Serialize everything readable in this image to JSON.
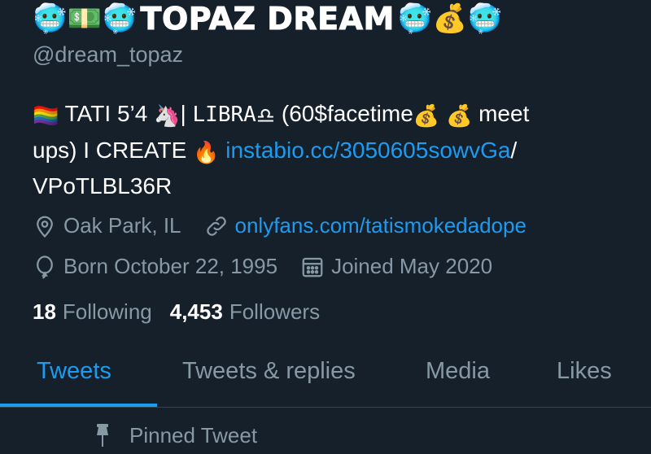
{
  "profile": {
    "display_name": "TOPAZ DREAM",
    "name_emojis_left": [
      "🥶",
      "💵",
      "🥶"
    ],
    "name_emojis_right": [
      "🥶",
      "💰",
      "🥶"
    ],
    "handle": "@dream_topaz"
  },
  "bio": {
    "line1_flag": "🏳️‍🌈",
    "line1_text_a": "TATI 5’4",
    "line1_emoji_unicorn": "🦄",
    "line1_sep": "|",
    "line1_libra_word": "LIBRA",
    "line1_libra_sign": "♎",
    "line1_text_b": "(60$facetime",
    "line1_money1": "💰",
    "line1_money2": "💰",
    "line1_text_c": "meet",
    "line2_text_a": "ups) I CREATE",
    "line2_fire": "🔥",
    "line2_link": "instabio.cc/3050605sowvGa",
    "line2_slash": "/",
    "line3_text": "VPoTLBL36R"
  },
  "meta": {
    "location": "Oak Park, IL",
    "website": "onlyfans.com/tatismokedadope",
    "birthday": "Born October 22, 1995",
    "joined": "Joined May 2020"
  },
  "stats": {
    "following_count": "18",
    "following_label": "Following",
    "followers_count": "4,453",
    "followers_label": "Followers"
  },
  "tabs": {
    "tweets": "Tweets",
    "replies": "Tweets & replies",
    "media": "Media",
    "likes": "Likes",
    "active": "tweets"
  },
  "pinned": {
    "label": "Pinned Tweet"
  },
  "colors": {
    "background": "#15202b",
    "accent": "#1d9bf0",
    "secondary_text": "#8899a6",
    "divider": "#38444d"
  },
  "icons": {
    "location": "location-pin-icon",
    "link": "link-icon",
    "birthday": "balloon-icon",
    "calendar": "calendar-icon",
    "pin": "pin-icon"
  }
}
